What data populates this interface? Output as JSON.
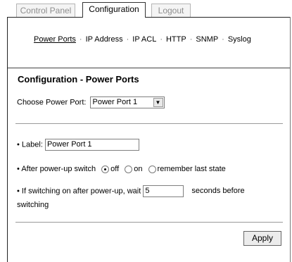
{
  "tabs": [
    {
      "label": "Control Panel",
      "active": false
    },
    {
      "label": "Configuration",
      "active": true
    },
    {
      "label": "Logout",
      "active": false
    }
  ],
  "subnav": {
    "items": [
      "Power Ports",
      "IP Address",
      "IP ACL",
      "HTTP",
      "SNMP",
      "Syslog"
    ],
    "separator": "·",
    "active": "Power Ports"
  },
  "page": {
    "title": "Configuration - Power Ports",
    "choose_label": "Choose Power Port:",
    "choose_value": "Power Port 1"
  },
  "form": {
    "bullet": "•",
    "label_text": "Label:",
    "label_value": "Power Port 1",
    "after_powerup_text": "After power-up switch",
    "radio_off": "off",
    "radio_on": "on",
    "radio_remember": "remember last state",
    "selected_option": "off",
    "wait_text": "If switching on after power-up, wait",
    "wait_value": "5",
    "wait_suffix": "seconds before",
    "wait_suffix2": "switching"
  },
  "actions": {
    "apply_label": "Apply"
  },
  "colors": {
    "tab_inactive_text": "#8e8e8e",
    "border_dark": "#222222",
    "divider": "#9a9a9a"
  },
  "icons": {
    "dropdown": "chevron-down-icon",
    "radio": "radio-icon"
  }
}
